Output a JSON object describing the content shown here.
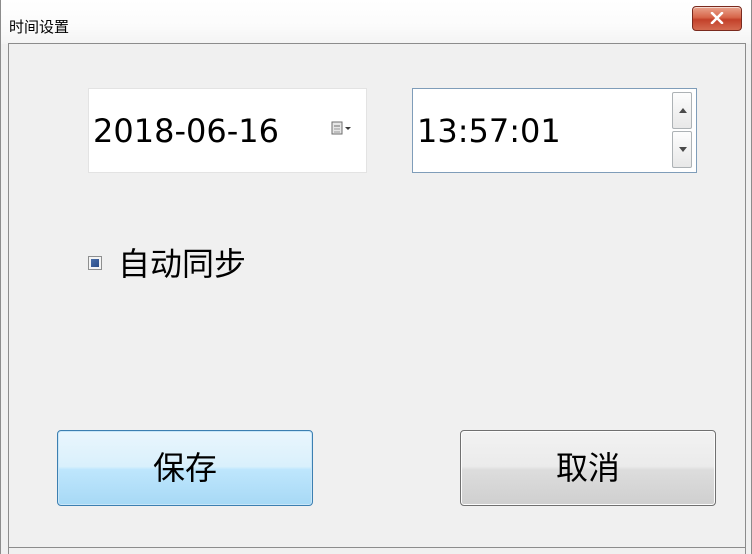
{
  "window": {
    "title": "时间设置"
  },
  "date_picker": {
    "value": "2018-06-16",
    "icon": "calendar-icon"
  },
  "time_picker": {
    "value": "13:57:01",
    "up_icon": "chevron-up-icon",
    "down_icon": "chevron-down-icon"
  },
  "auto_sync": {
    "label": "自动同步",
    "checked": true
  },
  "buttons": {
    "save_label": "保存",
    "cancel_label": "取消"
  },
  "colors": {
    "close_button": "#c9452e",
    "save_button": "#bee6fd",
    "checkbox_accent": "#2a4c87"
  }
}
